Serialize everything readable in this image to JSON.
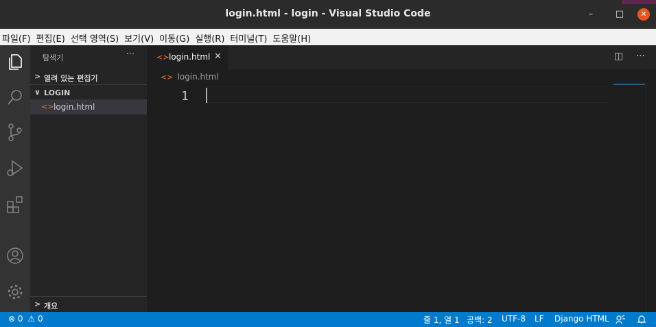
{
  "window": {
    "title": "login.html - login - Visual Studio Code",
    "minimize": "–",
    "maximize": "□",
    "close": "✕"
  },
  "menu": [
    "파일(F)",
    "편집(E)",
    "선택 영역(S)",
    "보기(V)",
    "이동(G)",
    "실행(R)",
    "터미널(T)",
    "도움말(H)"
  ],
  "activity_icons": [
    "files-icon",
    "search-icon",
    "source-control-icon",
    "run-debug-icon",
    "extensions-icon",
    "account-icon",
    "gear-icon"
  ],
  "sidebar": {
    "title": "탐색기",
    "more": "···",
    "open_editors": "열려 있는 편집기",
    "folder": "LOGIN",
    "file": "login.html",
    "outline": "개요"
  },
  "editor": {
    "tab_label": "login.html",
    "tab_close": "✕",
    "file_icon": "<>",
    "breadcrumb": "login.html",
    "line_number": "1",
    "split": "◫",
    "more": "···"
  },
  "status": {
    "errors": "0",
    "warnings": "0",
    "position": "줄 1, 열 1",
    "spaces": "공백: 2",
    "encoding": "UTF-8",
    "eol": "LF",
    "language": "Django HTML"
  },
  "colors": {
    "accent": "#007acc",
    "close_button": "#e95420",
    "file_icon": "#e37933"
  }
}
